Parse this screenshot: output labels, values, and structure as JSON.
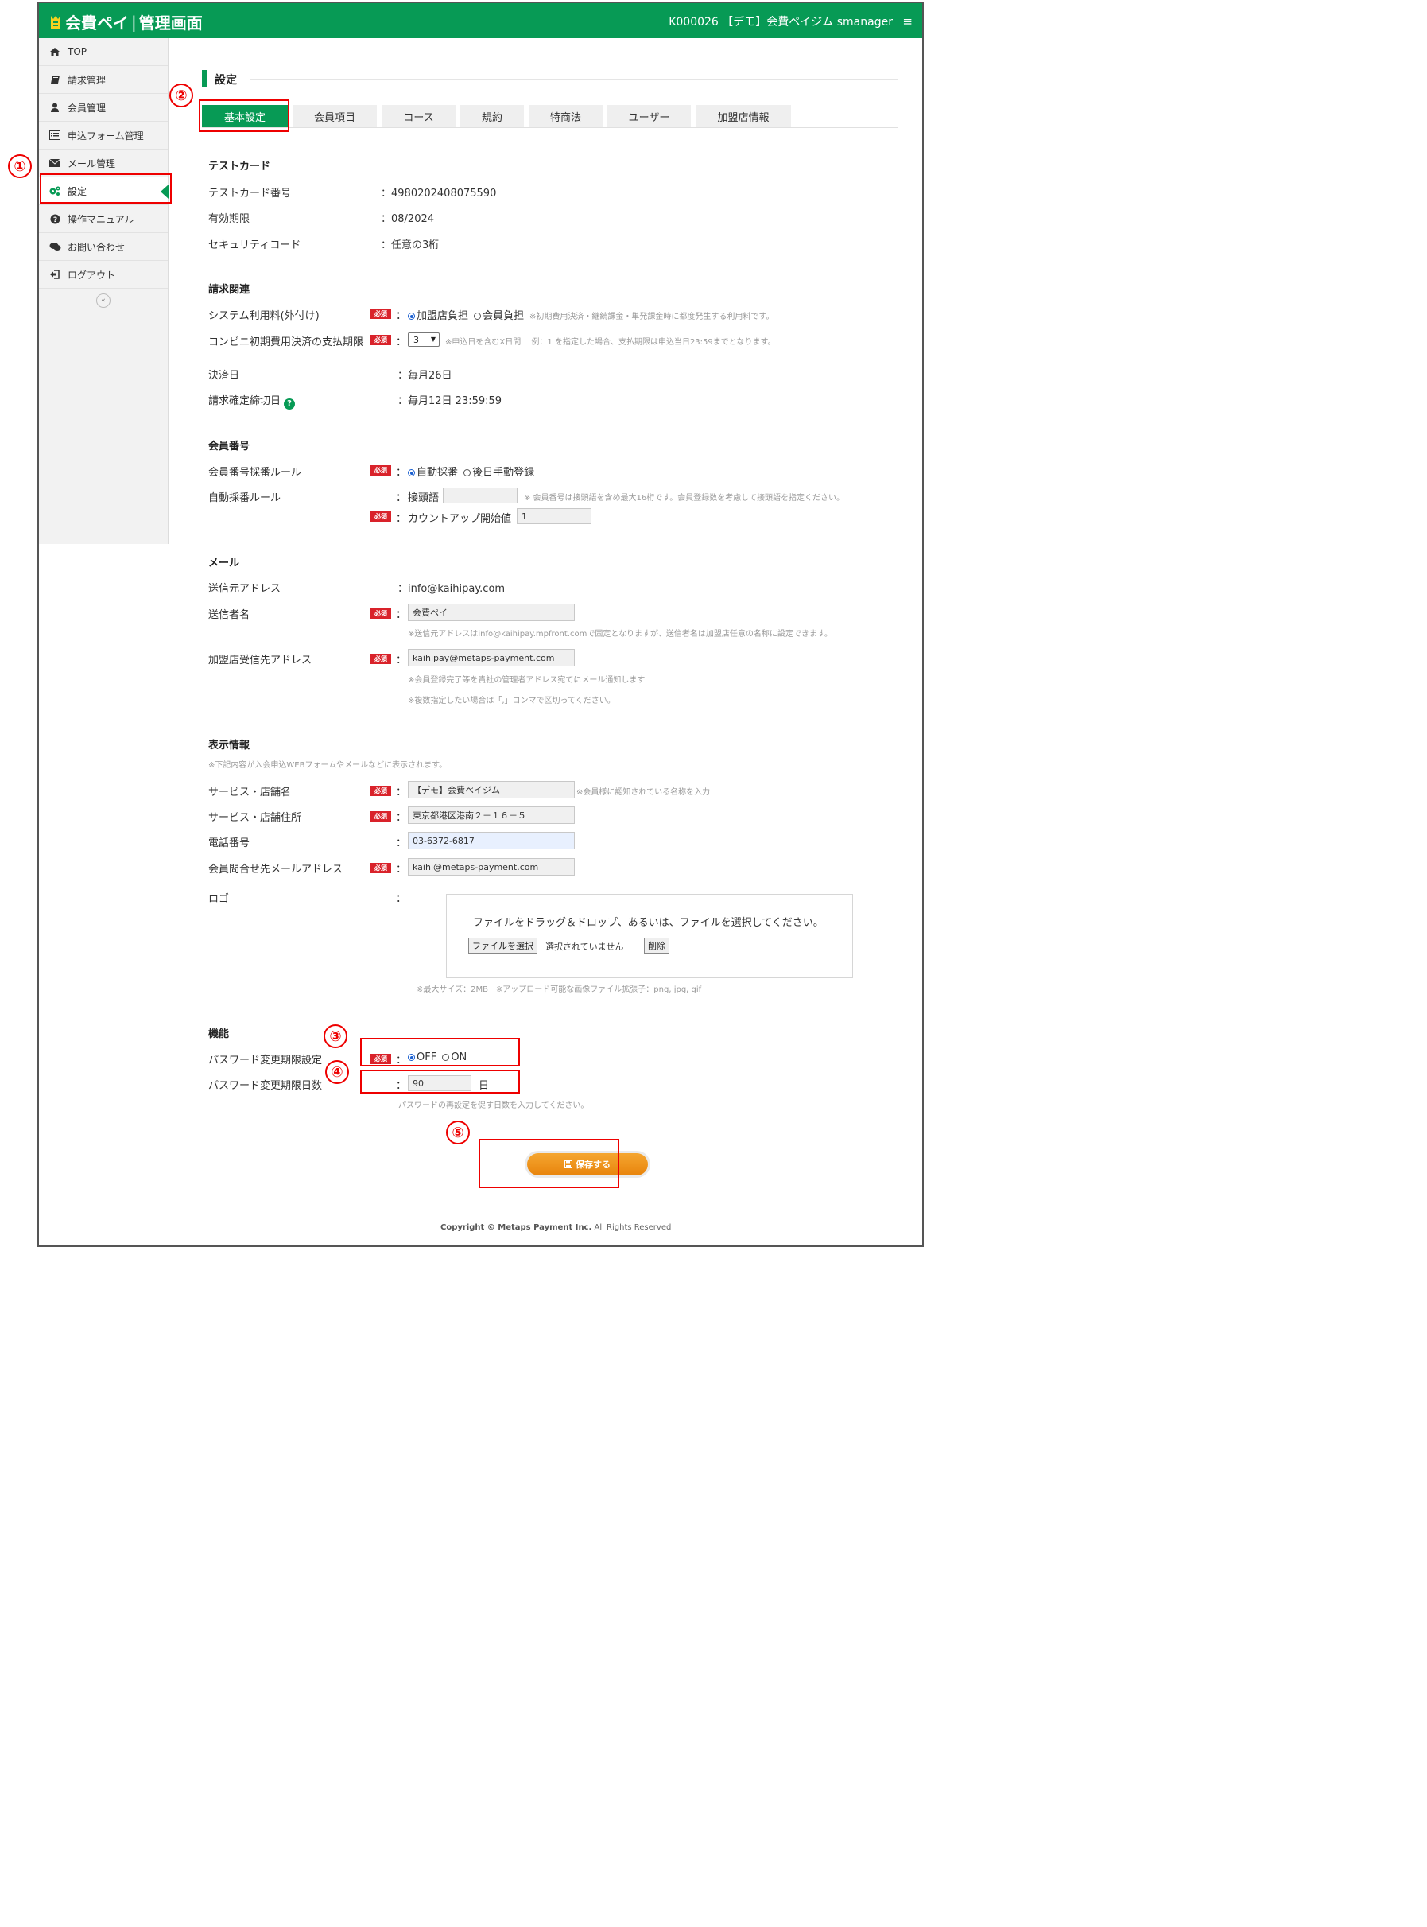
{
  "header": {
    "logo_text": "会費ペイ",
    "logo_separator": "|",
    "logo_sub": "管理画面",
    "account": "K000026 【デモ】会費ペイジム smanager",
    "menu_icon": "≡"
  },
  "sidebar": {
    "items": [
      {
        "label": "TOP",
        "icon": "home-icon"
      },
      {
        "label": "請求管理",
        "icon": "book-icon"
      },
      {
        "label": "会員管理",
        "icon": "user-icon"
      },
      {
        "label": "申込フォーム管理",
        "icon": "list-icon"
      },
      {
        "label": "メール管理",
        "icon": "envelope-icon"
      },
      {
        "label": "設定",
        "icon": "gears-icon",
        "active": true
      },
      {
        "label": "操作マニュアル",
        "icon": "question-icon"
      },
      {
        "label": "お問い合わせ",
        "icon": "comments-icon"
      },
      {
        "label": "ログアウト",
        "icon": "signout-icon"
      }
    ],
    "collapse_label": "«"
  },
  "page": {
    "title": "設定",
    "tabs": [
      "基本設定",
      "会員項目",
      "コース",
      "規約",
      "特商法",
      "ユーザー",
      "加盟店情報"
    ]
  },
  "test_card": {
    "heading": "テストカード",
    "number_label": "テストカード番号",
    "number_value": "：4980202408075590",
    "expiry_label": "有効期限",
    "expiry_value": "：08/2024",
    "cvc_label": "セキュリティコード",
    "cvc_value": "：任意の3桁"
  },
  "billing": {
    "heading": "請求関連",
    "fee_label": "システム利用料(外付け)",
    "fee_option1": "加盟店負担",
    "fee_option2": "会員負担",
    "fee_note": "※初期費用決済・継続課金・単発課金時に都度発生する利用料です。",
    "conv_label": "コンビニ初期費用決済の支払期限",
    "conv_value": "3",
    "conv_note": "※申込日を含むX日間　 例：1 を指定した場合、支払期限は申込当日23:59までとなります。",
    "settle_label": "決済日",
    "settle_value": "：毎月26日",
    "close_label": "請求確定締切日",
    "close_value": "：毎月12日 23:59:59"
  },
  "member_no": {
    "heading": "会員番号",
    "rule_label": "会員番号採番ルール",
    "rule_option1": "自動採番",
    "rule_option2": "後日手動登録",
    "auto_label": "自動採番ルール",
    "prefix_label": "接頭語",
    "prefix_value": "",
    "prefix_note": "※ 会員番号は接頭語を含め最大16桁です。会員登録数を考慮して接頭語を指定ください。",
    "count_label": "カウントアップ開始値",
    "count_value": "1"
  },
  "mail": {
    "heading": "メール",
    "from_label": "送信元アドレス",
    "from_value": "：info@kaihipay.com",
    "sender_label": "送信者名",
    "sender_value": "会費ペイ",
    "sender_note": "※送信元アドレスはinfo@kaihipay.mpfront.comで固定となりますが、送信者名は加盟店任意の名称に設定できます。",
    "merchant_label": "加盟店受信先アドレス",
    "merchant_value": "kaihipay@metaps-payment.com",
    "merchant_note1": "※会員登録完了等を貴社の管理者アドレス宛てにメール通知します",
    "merchant_note2": "※複数指定したい場合は「,」コンマで区切ってください。"
  },
  "display": {
    "heading": "表示情報",
    "note": "※下記内容が入会申込WEBフォームやメールなどに表示されます。",
    "service_label": "サービス・店舗名",
    "service_value": "【デモ】会費ペイジム",
    "service_note": "※会員様に認知されている名称を入力",
    "address_label": "サービス・店舗住所",
    "address_value": "東京都港区港南２－１６－５",
    "phone_label": "電話番号",
    "phone_value": "03-6372-6817",
    "contact_label": "会員問合せ先メールアドレス",
    "contact_value": "kaihi@metaps-payment.com",
    "logo_label": "ロゴ",
    "drop_text": "ファイルをドラッグ＆ドロップ、あるいは、ファイルを選択してください。",
    "choose_file": "ファイルを選択",
    "no_file": "選択されていません",
    "delete": "削除",
    "logo_note": "※最大サイズ：2MB　※アップロード可能な画像ファイル拡張子：png, jpg, gif"
  },
  "function": {
    "heading": "機能",
    "pw_label": "パスワード変更期限設定",
    "pw_off": "OFF",
    "pw_on": "ON",
    "pw_days_label": "パスワード変更期限日数",
    "pw_days_value": "90",
    "pw_days_unit": "日",
    "pw_days_note": "パスワードの再設定を促す日数を入力してください。"
  },
  "required_badge": "必須",
  "colon": "：",
  "save_label": "保存する",
  "footer": {
    "copyright_bold": "Copyright © Metaps Payment Inc.",
    "copyright_rest": " All Rights Reserved"
  },
  "annotations": [
    "①",
    "②",
    "③",
    "④",
    "⑤"
  ],
  "colors": {
    "brand": "#079a55",
    "highlight": "#e00000",
    "save": "#f0961e",
    "required": "#d9222a"
  }
}
